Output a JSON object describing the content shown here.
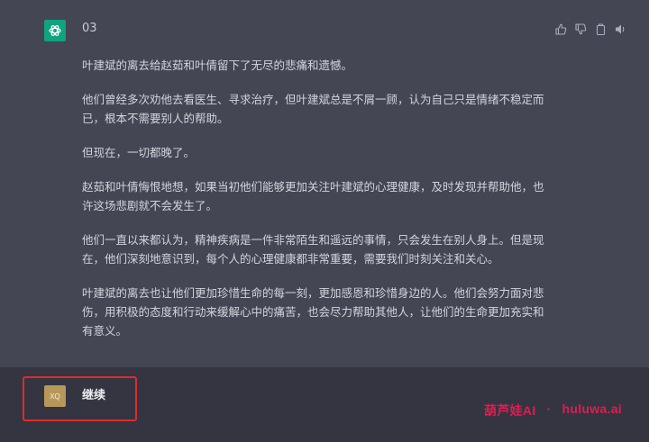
{
  "assistant": {
    "id": "03",
    "paragraphs": [
      "叶建斌的离去给赵茹和叶倩留下了无尽的悲痛和遗憾。",
      "他们曾经多次劝他去看医生、寻求治疗，但叶建斌总是不屑一顾，认为自己只是情绪不稳定而已，根本不需要别人的帮助。",
      "但现在，一切都晚了。",
      "赵茹和叶倩悔恨地想，如果当初他们能够更加关注叶建斌的心理健康，及时发现并帮助他，也许这场悲剧就不会发生了。",
      "他们一直以来都认为，精神疾病是一件非常陌生和遥远的事情，只会发生在别人身上。但是现在，他们深刻地意识到，每个人的心理健康都非常重要，需要我们时刻关注和关心。",
      "叶建斌的离去也让他们更加珍惜生命的每一刻，更加感恩和珍惜身边的人。他们会努力面对悲伤，用积极的态度和行动来缓解心中的痛苦，也会尽力帮助其他人，让他们的生命更加充实和有意义。"
    ],
    "actions": [
      "thumbs-up-icon",
      "thumbs-down-icon",
      "copy-icon",
      "speaker-icon"
    ]
  },
  "user": {
    "avatar_initials": "XQ",
    "message": "继续"
  },
  "watermark": {
    "brand": "葫芦娃AI",
    "separator": "·",
    "site": "huluwa.ai"
  },
  "colors": {
    "assistant_bg": "#444654",
    "user_bg": "#343541",
    "gpt_avatar": "#10a37f",
    "user_avatar": "#b8975a",
    "highlight": "#e02b2b",
    "watermark": "#e11d4f"
  }
}
